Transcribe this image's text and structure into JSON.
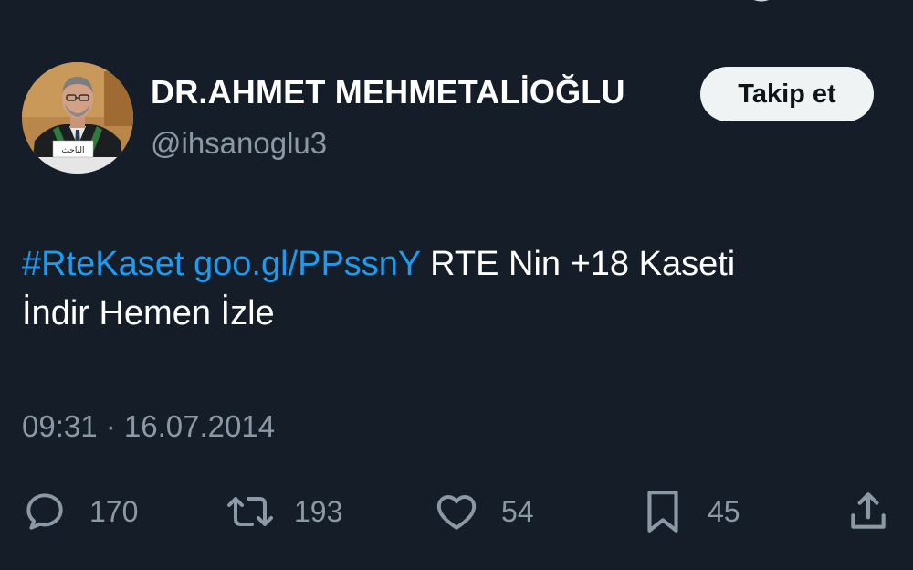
{
  "user": {
    "display_name": "DR.AHMET MEHMETALİOĞLU",
    "handle": "@ihsanoglu3",
    "avatar_icon": "profile-photo",
    "avatar_nameplate": "الباحث"
  },
  "follow_button": {
    "label": "Takip et"
  },
  "tweet": {
    "hashtag": "#RteKaset",
    "link": "goo.gl/PPssnY",
    "text_line1": " RTE Nin +18 Kaseti",
    "text_line2": "İndir Hemen İzle"
  },
  "timestamp": "09:31 · 16.07.2014",
  "actions": {
    "replies": {
      "icon": "reply-icon",
      "count": "170"
    },
    "retweets": {
      "icon": "retweet-icon",
      "count": "193"
    },
    "likes": {
      "icon": "heart-icon",
      "count": "54"
    },
    "bookmarks": {
      "icon": "bookmark-icon",
      "count": "45"
    },
    "share": {
      "icon": "share-icon"
    }
  },
  "colors": {
    "background": "#151d28",
    "link": "#1d9bf0",
    "muted": "#8b98a5",
    "text": "#ffffff",
    "button_bg": "#eff3f4"
  }
}
